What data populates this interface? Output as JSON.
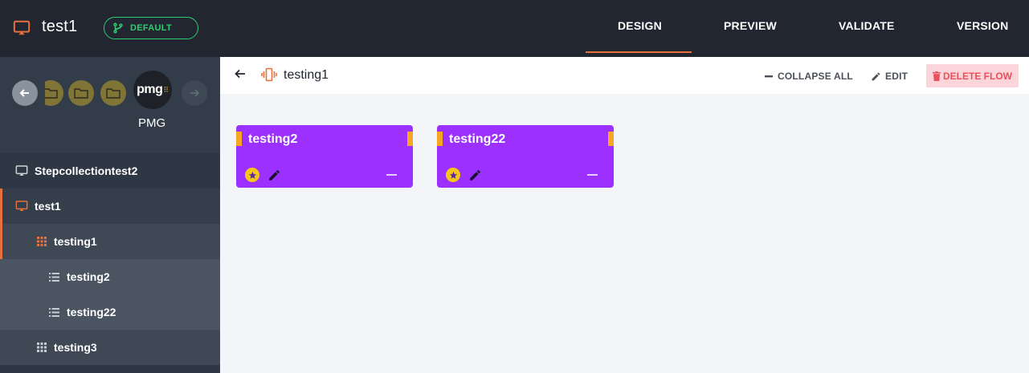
{
  "topbar": {
    "app_title": "test1",
    "branch_label": "DEFAULT",
    "tabs": [
      {
        "label": "DESIGN",
        "active": true
      },
      {
        "label": "PREVIEW",
        "active": false
      },
      {
        "label": "VALIDATE",
        "active": false
      },
      {
        "label": "VERSION",
        "active": false
      }
    ]
  },
  "sidebar": {
    "workspace_logo": "pmg",
    "workspace_label": "PMG",
    "tree": [
      {
        "label": "Stepcollectiontest2",
        "icon": "monitor-icon"
      },
      {
        "label": "test1",
        "icon": "monitor-icon",
        "active": true
      },
      {
        "label": "testing1",
        "icon": "grid-icon",
        "selected": true
      },
      {
        "label": "testing2",
        "icon": "list-icon"
      },
      {
        "label": "testing22",
        "icon": "list-icon"
      },
      {
        "label": "testing3",
        "icon": "grid-icon"
      }
    ]
  },
  "content": {
    "flow_title": "testing1",
    "collapse_all_label": "COLLAPSE ALL",
    "edit_label": "EDIT",
    "delete_label": "DELETE FLOW"
  },
  "cards": [
    {
      "title": "testing2"
    },
    {
      "title": "testing22"
    }
  ],
  "colors": {
    "accent": "#e8703a",
    "card": "#9b30ff",
    "branch": "#2ecc71",
    "danger": "#e8505b"
  }
}
